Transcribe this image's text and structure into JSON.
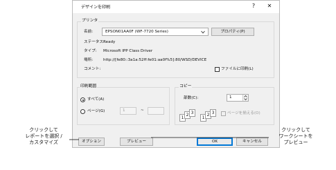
{
  "dialog": {
    "title": "デザインを印刷",
    "help_label": "?",
    "close_label": "✕"
  },
  "printer": {
    "group_label": "プリンタ",
    "name_label": "名前:",
    "name_value": "EPSON01AA0F (WF-7720 Series)",
    "properties_label": "プロパティ(P)",
    "status_label": "ステータス:",
    "status_value": "Ready",
    "type_label": "タイプ:",
    "type_value": "Microsoft IPP Class Driver",
    "location_label": "場所:",
    "location_value": "http://[fe80::3a1a:52ff:fe01:aa0f%5]:80/WSD/DEVICE",
    "comment_label": "コメント:",
    "print_to_file_label": "ファイルに印刷(L)"
  },
  "range": {
    "group_label": "印刷範囲",
    "all_label": "すべて(A)",
    "pages_label": "ページ(G)",
    "from_value": "1",
    "tilde": "~",
    "to_value": ""
  },
  "copies": {
    "group_label": "コピー",
    "count_label": "部数(C):",
    "count_value": "1",
    "collate_label": "ページを揃える(O)",
    "collate_icons": [
      {
        "a": "1",
        "b": "2",
        "c": "3"
      },
      {
        "a": "1",
        "b": "2",
        "c": "3"
      }
    ]
  },
  "buttons": {
    "options": "オプション",
    "preview": "プレビュー",
    "ok": "OK",
    "cancel": "キャンセル"
  },
  "callouts": {
    "left": [
      "クリックして",
      "レポートを選択 /",
      "カスタマイズ"
    ],
    "right": [
      "クリックして",
      "ワークシートを",
      "プレビュー"
    ]
  },
  "colors": {
    "accent": "#0078d7",
    "dialog_bg": "#f0f0f0"
  }
}
